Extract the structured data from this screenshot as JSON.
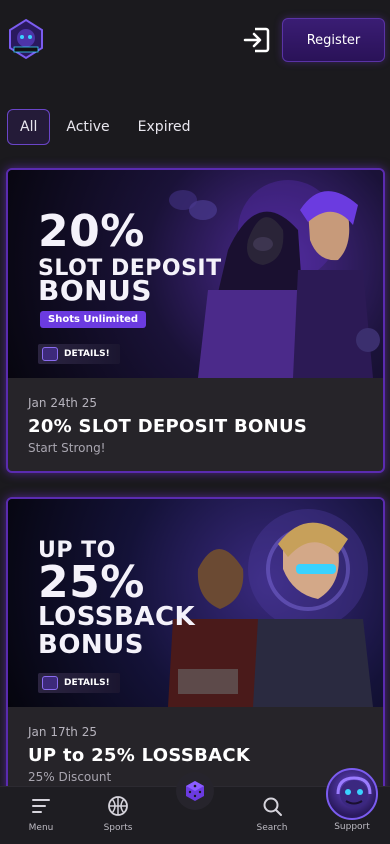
{
  "header": {
    "register_label": "Register"
  },
  "tabs": [
    {
      "label": "All",
      "active": true
    },
    {
      "label": "Active",
      "active": false
    },
    {
      "label": "Expired",
      "active": false
    }
  ],
  "promos": [
    {
      "banner": {
        "line1": "20%",
        "line2": "SLOT DEPOSIT",
        "line3": "BONUS",
        "pill": "Shots Unlimited",
        "details": "DETAILS!"
      },
      "date": "Jan 24th 25",
      "title": "20% SLOT DEPOSIT BONUS",
      "subtitle": "Start Strong!"
    },
    {
      "banner": {
        "line1": "UP TO",
        "line2": "25%",
        "line3": "LOSSBACK",
        "line4": "BONUS",
        "details": "DETAILS!"
      },
      "date": "Jan 17th 25",
      "title": "UP to 25% LOSSBACK",
      "subtitle": "25% Discount"
    }
  ],
  "nav": {
    "menu": "Menu",
    "sports": "Sports",
    "search": "Search",
    "support": "Support"
  },
  "colors": {
    "accent": "#5a2bb0",
    "background": "#1b1a1e",
    "register": "#2a1258"
  }
}
